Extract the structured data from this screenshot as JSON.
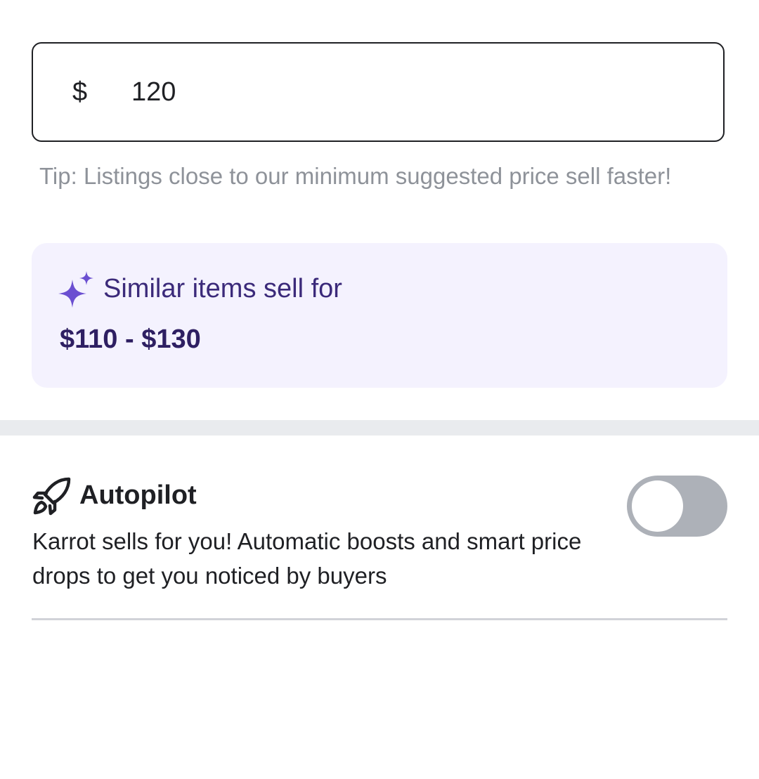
{
  "price": {
    "currency_symbol": "$",
    "value": "120"
  },
  "tip": "Tip: Listings close to our minimum suggested price sell faster!",
  "suggestion": {
    "title": "Similar items sell for",
    "range": "$110 - $130",
    "icon": "sparkle-icon",
    "accent_color": "#6b4fd1"
  },
  "autopilot": {
    "icon": "rocket-icon",
    "title": "Autopilot",
    "description": "Karrot sells for you! Automatic boosts and smart price drops to get you noticed by buyers",
    "toggle_on": false
  }
}
